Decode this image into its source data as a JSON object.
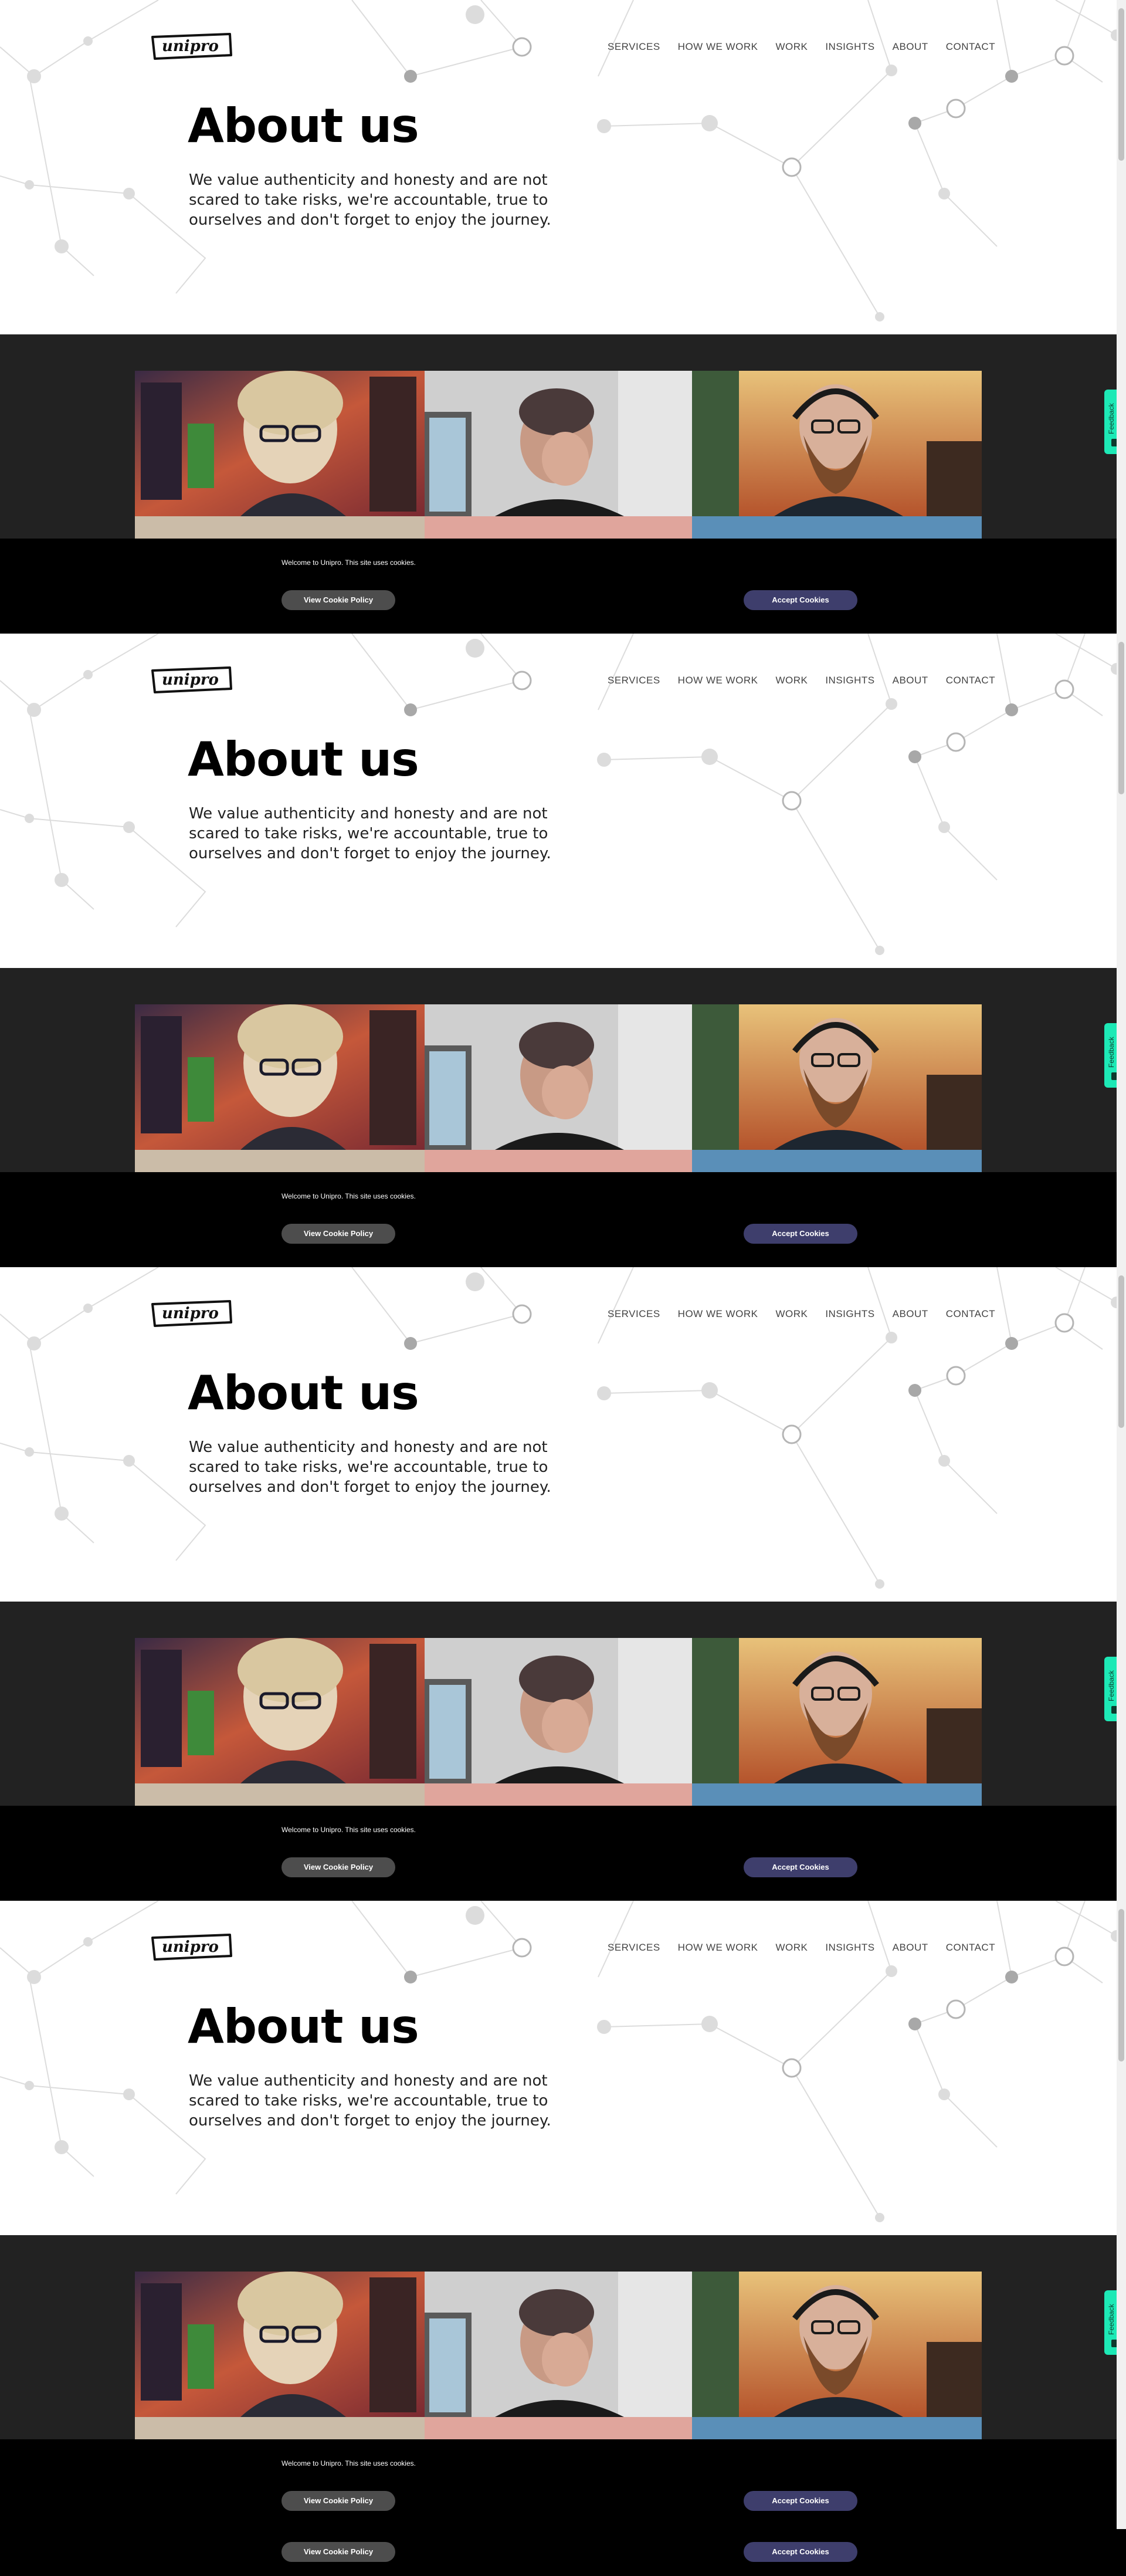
{
  "brand": {
    "logo_text": "unipro"
  },
  "nav": {
    "items": [
      {
        "label": "SERVICES"
      },
      {
        "label": "HOW WE WORK"
      },
      {
        "label": "WORK"
      },
      {
        "label": "INSIGHTS"
      },
      {
        "label": "ABOUT"
      },
      {
        "label": "CONTACT"
      }
    ]
  },
  "hero": {
    "title": "About us",
    "intro": "We value authenticity and honesty and are not scared to take risks, we're accountable, true to ourselves and don't forget to enjoy the journey."
  },
  "cookie": {
    "message": "Welcome to Unipro. This site uses cookies.",
    "policy_label": "View Cookie Policy",
    "accept_label": "Accept Cookies"
  },
  "feedback": {
    "label": "Feedback"
  },
  "colors": {
    "dark_band": "#222222",
    "cookie_bg": "#000000",
    "accept_button": "#3e3e6c",
    "policy_button": "#4d4d4d",
    "feedback_tab": "#1de9b6"
  }
}
